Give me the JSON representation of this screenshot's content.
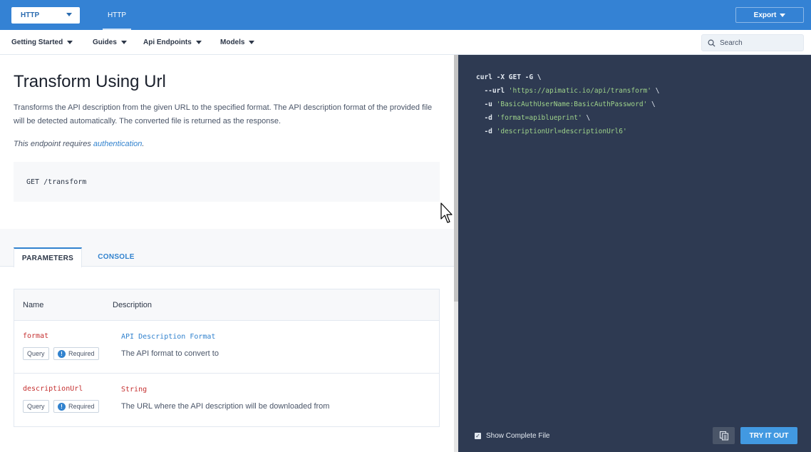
{
  "topbar": {
    "language_select": "HTTP",
    "active_tab": "HTTP",
    "export_label": "Export"
  },
  "nav": {
    "items": [
      {
        "label": "Getting Started"
      },
      {
        "label": "Guides"
      },
      {
        "label": "Api Endpoints"
      },
      {
        "label": "Models"
      }
    ],
    "search_placeholder": "Search"
  },
  "content": {
    "title": "Transform Using Url",
    "description": "Transforms the API description from the given URL to the specified format. The API description format of the provided file will be detected automatically. The converted file is returned as the response.",
    "auth_prefix": "This endpoint requires ",
    "auth_link": "authentication",
    "auth_suffix": ".",
    "endpoint": "GET /transform",
    "tabs": {
      "parameters": "PARAMETERS",
      "console": "CONSOLE"
    },
    "table": {
      "col_name": "Name",
      "col_description": "Description",
      "rows": [
        {
          "name": "format",
          "type": "API Description Format",
          "type_color": "#3182ce",
          "location": "Query",
          "required": "Required",
          "description": "The API format to convert to"
        },
        {
          "name": "descriptionUrl",
          "type": "String",
          "type_color": "#c53030",
          "location": "Query",
          "required": "Required",
          "description": "The URL where the API description will be downloaded from"
        }
      ]
    }
  },
  "code_panel": {
    "line1": "curl -X GET -G \\",
    "line2_flag": "--url",
    "line2_str": "'https://apimatic.io/api/transform'",
    "line2_end": " \\",
    "line3_flag": "-u",
    "line3_str": "'BasicAuthUserName:BasicAuthPassword'",
    "line3_end": " \\",
    "line4_flag": "-d",
    "line4_str": "'format=apiblueprint'",
    "line4_end": " \\",
    "line5_flag": "-d",
    "line5_str": "'descriptionUrl=descriptionUrl6'",
    "show_complete_file": "Show Complete File",
    "try_it_out": "TRY IT OUT"
  },
  "colors": {
    "brand_blue": "#3482d4",
    "code_bg": "#2e3a52",
    "link": "#3182ce",
    "string_green": "#9ed28a"
  }
}
